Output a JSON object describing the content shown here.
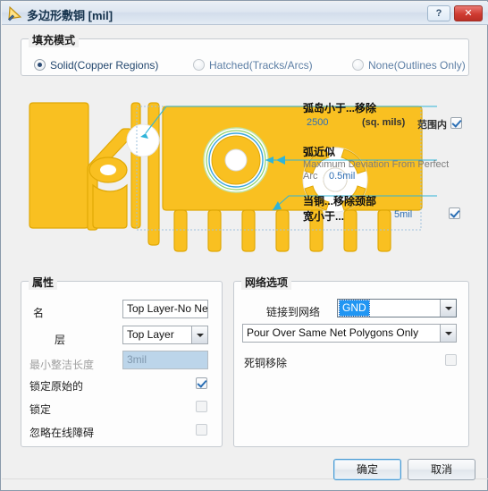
{
  "window": {
    "title": "多边形敷铜 [mil]",
    "icon": "polygon-pour-icon",
    "help_label": "?",
    "close_label": "✕"
  },
  "fill_mode": {
    "group_title": "填充模式",
    "options": [
      {
        "label": "Solid(Copper Regions)",
        "checked": true
      },
      {
        "label": "Hatched(Tracks/Arcs)",
        "checked": false
      },
      {
        "label": "None(Outlines Only)",
        "checked": false
      }
    ]
  },
  "annotations": {
    "island_removal": {
      "title": "弧岛小于...移除",
      "value": "2500",
      "unit": "(sq. mils)",
      "scope_label": "范围内",
      "scope_checked": true
    },
    "arc_approx": {
      "title": "弧近似",
      "sub_line1": "Maximum Deviation From Perfect",
      "sub_line2": "Arc",
      "value": "0.5mil"
    },
    "neck_removal": {
      "title_line1": "当铜...移除颈部",
      "title_line2": "宽小于...",
      "value": "5mil",
      "checked": true
    }
  },
  "properties": {
    "group_title": "属性",
    "name_label": "名",
    "name_value": "Top Layer-No Net",
    "layer_label": "层",
    "layer_value": "Top Layer",
    "min_prim_label": "最小整洁长度",
    "min_prim_value": "3mil",
    "checkboxes": [
      {
        "label": "锁定原始的",
        "checked": true,
        "disabled": false
      },
      {
        "label": "锁定",
        "checked": false,
        "disabled": true
      },
      {
        "label": "忽略在线障碍",
        "checked": false,
        "disabled": true
      }
    ]
  },
  "net_options": {
    "group_title": "网络选项",
    "connect_label": "链接到网络",
    "connect_value": "GND",
    "pour_value": "Pour Over Same Net Polygons Only",
    "dead_copper_label": "死铜移除",
    "dead_copper_checked": false
  },
  "footer": {
    "ok_label": "确定",
    "cancel_label": "取消"
  },
  "colors": {
    "copper": "#f9c021",
    "copper_edge": "#e4a906",
    "accent_blue": "#2196f3",
    "link_text": "#2f6fb5",
    "close_red": "#cf3b31"
  }
}
